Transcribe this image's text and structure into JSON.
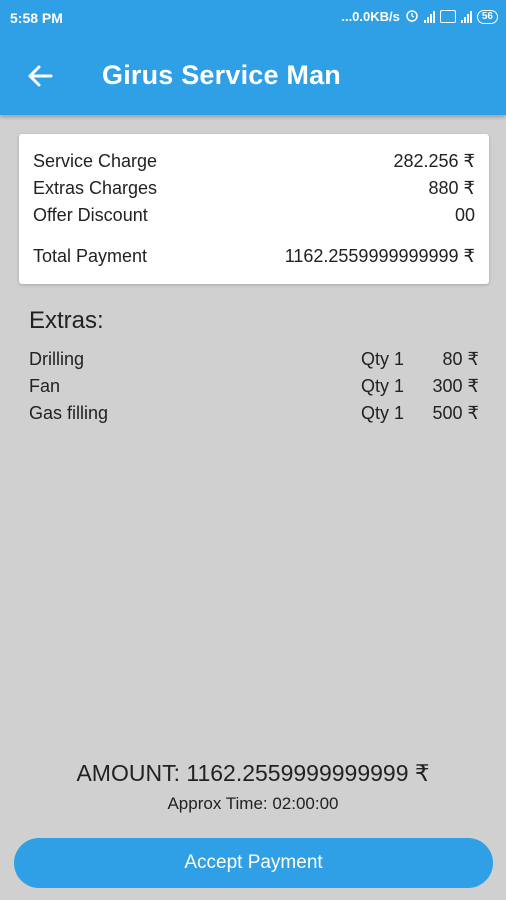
{
  "status_bar": {
    "time": "5:58 PM",
    "network_speed": "...0.0KB/s",
    "battery": "56"
  },
  "app_bar": {
    "back_icon": "arrow-left-icon",
    "title": "Girus Service Man"
  },
  "summary": {
    "service_charge_label": "Service Charge",
    "service_charge_value": "282.256 ₹",
    "extras_charges_label": "Extras Charges",
    "extras_charges_value": "880 ₹",
    "offer_discount_label": "Offer Discount",
    "offer_discount_value": "00",
    "total_payment_label": "Total Payment",
    "total_payment_value": "1162.2559999999999 ₹"
  },
  "extras": {
    "title": "Extras:",
    "items": [
      {
        "name": "Drilling",
        "qty": "Qty  1",
        "price": "80 ₹"
      },
      {
        "name": "Fan",
        "qty": "Qty  1",
        "price": "300 ₹"
      },
      {
        "name": "Gas filling",
        "qty": "Qty  1",
        "price": "500 ₹"
      }
    ]
  },
  "footer": {
    "amount_text": "AMOUNT:  1162.2559999999999 ₹",
    "approx_time_text": "Approx Time:  02:00:00",
    "accept_button_label": "Accept Payment"
  },
  "colors": {
    "primary": "#2f9fe6",
    "background": "#d0d0d0",
    "card": "#ffffff"
  }
}
